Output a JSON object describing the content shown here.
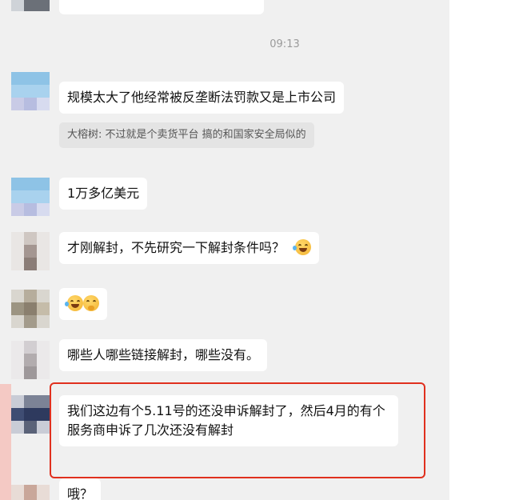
{
  "chat": {
    "timestamp": "09:13",
    "messages": [
      {
        "text": "规模太大了他经常被反垄断法罚款又是上市公司"
      },
      {
        "quote": "大榕树: 不过就是个卖货平台 搞的和国家安全局似的"
      },
      {
        "text": "1万多亿美元"
      },
      {
        "text": "才刚解封，不先研究一下解封条件吗？",
        "emoji": "laughing-crying-face-icon"
      },
      {
        "emojis": [
          "laughing-crying-face-icon",
          "thinking-face-icon"
        ]
      },
      {
        "text": "哪些人哪些链接解封，哪些没有。"
      },
      {
        "text": "我们这边有个5.11号的还没申诉解封了，然后4月的有个服务商申诉了几次还没有解封",
        "highlighted": true
      },
      {
        "text": "哦？"
      }
    ]
  },
  "colors": {
    "chat_background": "#f0f0f0",
    "bubble": "#ffffff",
    "quote_background": "#e4e4e4",
    "highlight": "#e0301e"
  }
}
